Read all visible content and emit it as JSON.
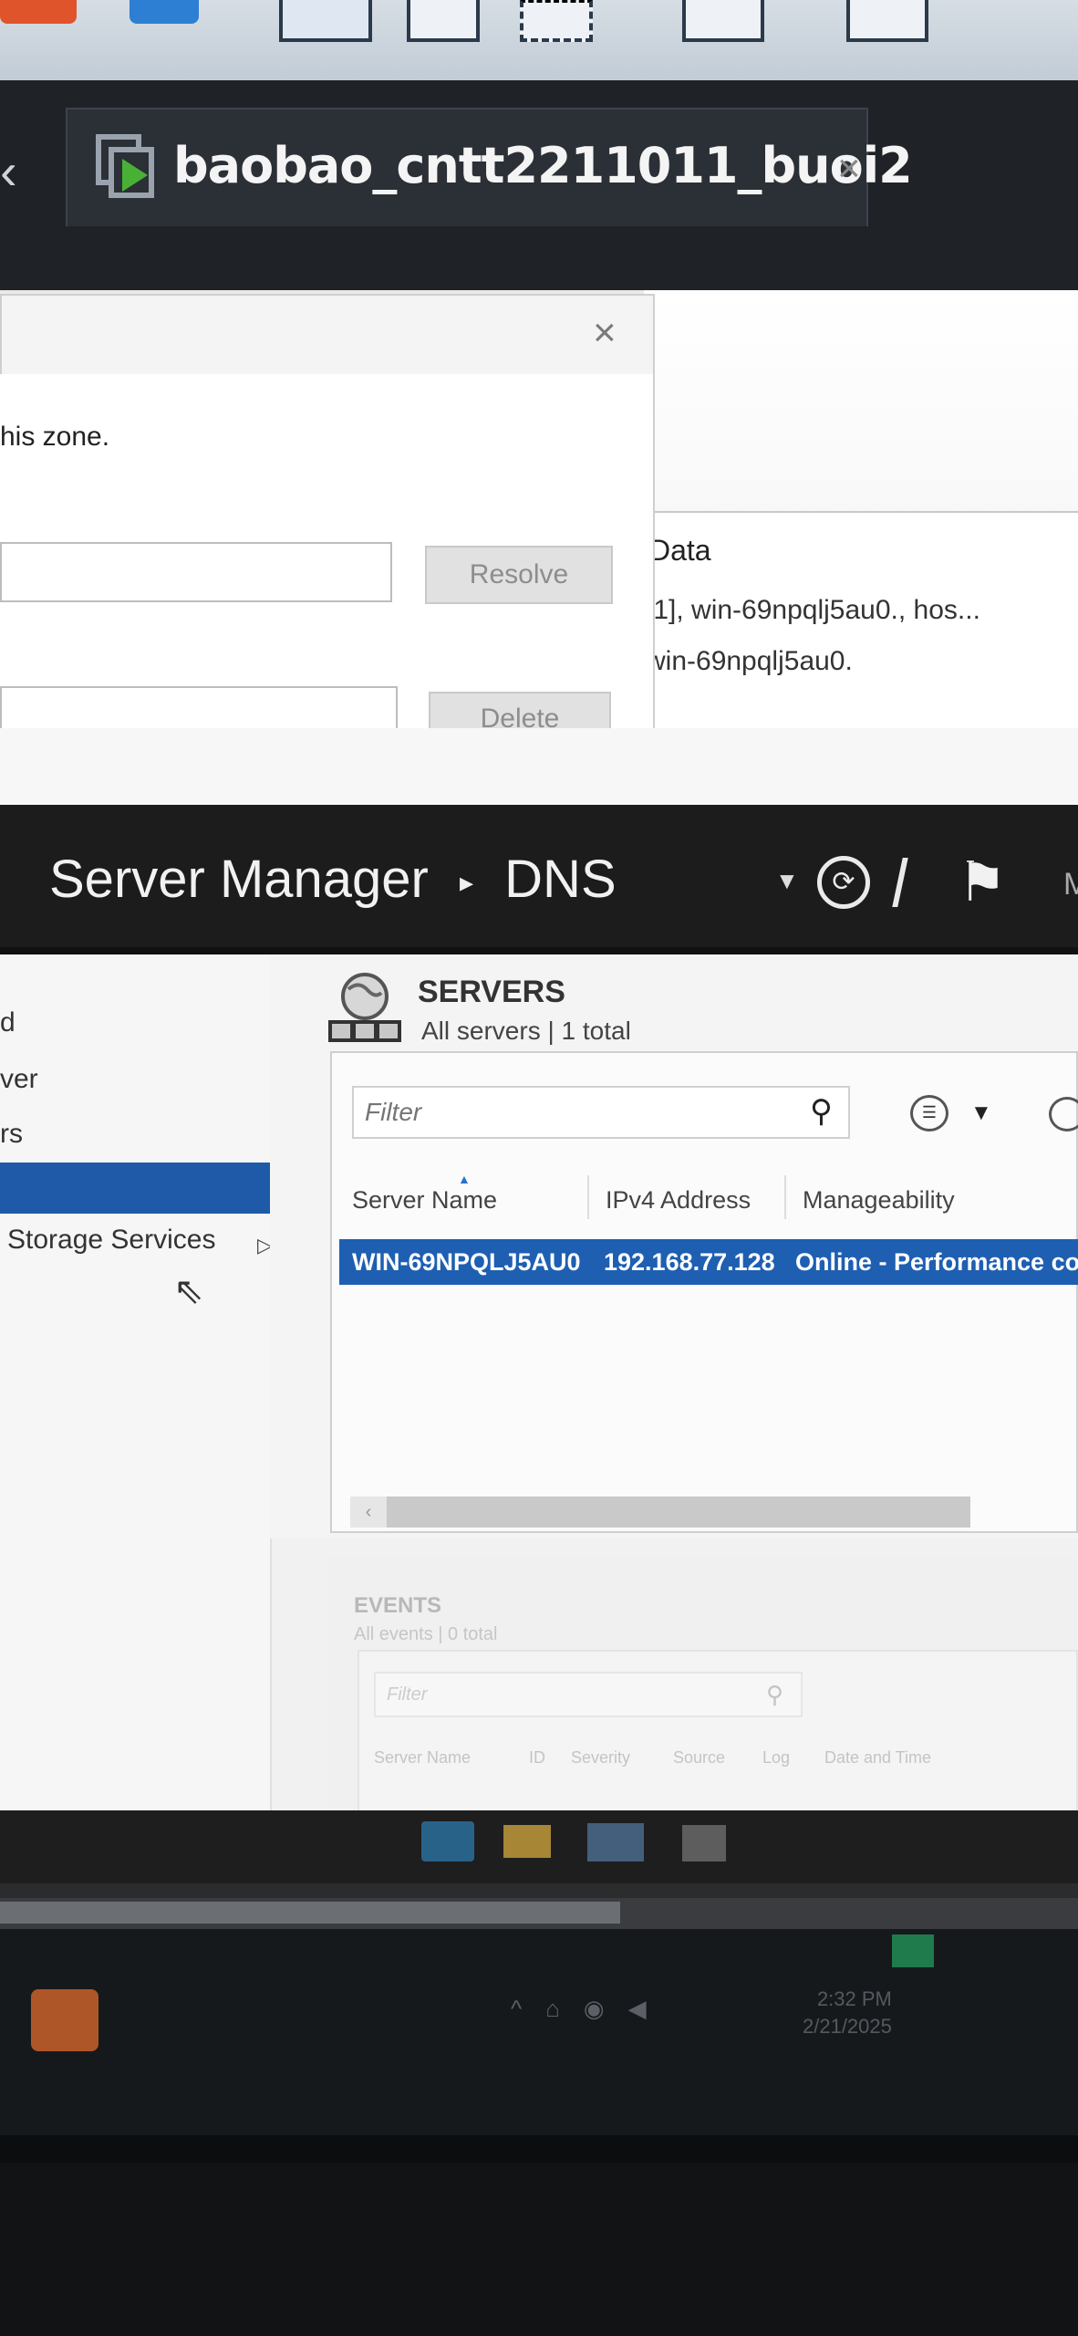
{
  "vm_tab": {
    "title": "baobao_cntt2211011_buoi2",
    "close_glyph": "×"
  },
  "dialog": {
    "zone_text": "his zone.",
    "resolve_label": "Resolve",
    "delete_label": "Delete",
    "close_glyph": "×"
  },
  "records_list": {
    "header": "Data",
    "rows": [
      "[1], win-69npqlj5au0., hos...",
      "win-69npqlj5au0."
    ]
  },
  "server_manager": {
    "title": "Server Manager",
    "breadcrumb_sep": "▸",
    "page": "DNS",
    "nav_items": [
      "d",
      "ver",
      "rs",
      "",
      "Storage Services"
    ]
  },
  "servers": {
    "title": "SERVERS",
    "subtitle": "All servers | 1 total",
    "filter_placeholder": "Filter",
    "columns": [
      "Server Name",
      "IPv4 Address",
      "Manageability"
    ],
    "rows": [
      {
        "name": "WIN-69NPQLJ5AU0",
        "ip": "192.168.77.128",
        "manageability": "Online - Performance co"
      }
    ]
  },
  "events": {
    "title": "EVENTS",
    "subtitle": "All events | 0 total",
    "filter_placeholder": "Filter",
    "columns": [
      "Server Name",
      "ID",
      "Severity",
      "Source",
      "Log",
      "Date and Time"
    ]
  },
  "host": {
    "clock_time": "2:32 PM",
    "clock_date": "2/21/2025"
  },
  "colors": {
    "selection_blue": "#1e5fb2",
    "sm_header": "#1c1c1c"
  }
}
